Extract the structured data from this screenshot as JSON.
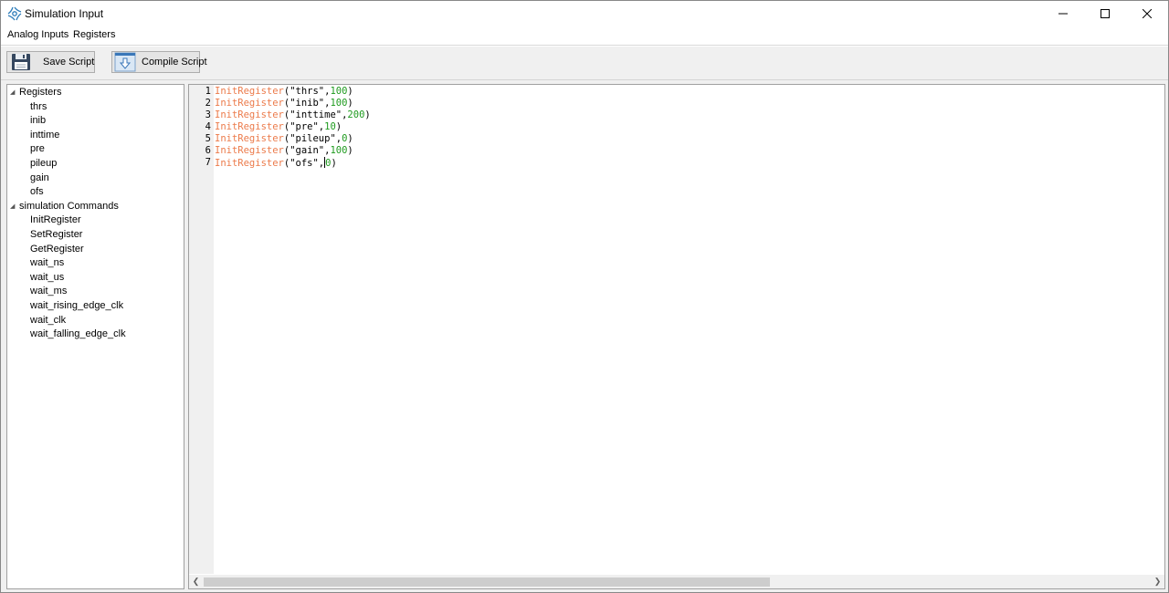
{
  "window": {
    "title": "Simulation Input",
    "controls": [
      "minimize",
      "maximize",
      "close"
    ]
  },
  "menu": {
    "items": [
      {
        "label": "Analog Inputs"
      },
      {
        "label": "Registers"
      }
    ]
  },
  "toolbar": {
    "save_label": "Save Script",
    "compile_label": "Compile Script",
    "save_icon": "floppy-disk-icon",
    "compile_icon": "download-arrow-icon"
  },
  "tree": {
    "groups": [
      {
        "label": "Registers",
        "expanded": true,
        "children": [
          "thrs",
          "inib",
          "inttime",
          "pre",
          "pileup",
          "gain",
          "ofs"
        ]
      },
      {
        "label": "simulation Commands",
        "expanded": true,
        "children": [
          "InitRegister",
          "SetRegister",
          "GetRegister",
          "wait_ns",
          "wait_us",
          "wait_ms",
          "wait_rising_edge_clk",
          "wait_clk",
          "wait_falling_edge_clk"
        ]
      }
    ]
  },
  "editor": {
    "lines": [
      {
        "n": "1",
        "fn": "InitRegister",
        "str": "\"thrs\"",
        "num": "100"
      },
      {
        "n": "2",
        "fn": "InitRegister",
        "str": "\"inib\"",
        "num": "100"
      },
      {
        "n": "3",
        "fn": "InitRegister",
        "str": "\"inttime\"",
        "num": "200"
      },
      {
        "n": "4",
        "fn": "InitRegister",
        "str": "\"pre\"",
        "num": "10"
      },
      {
        "n": "5",
        "fn": "InitRegister",
        "str": "\"pileup\"",
        "num": "0"
      },
      {
        "n": "6",
        "fn": "InitRegister",
        "str": "\"gain\"",
        "num": "100"
      },
      {
        "n": "7",
        "fn": "InitRegister",
        "str": "\"ofs\"",
        "num": "0"
      }
    ],
    "caret_line": 7,
    "colors": {
      "function": "#ec7b4b",
      "number": "#1e9a1e",
      "string": "#000000"
    }
  }
}
